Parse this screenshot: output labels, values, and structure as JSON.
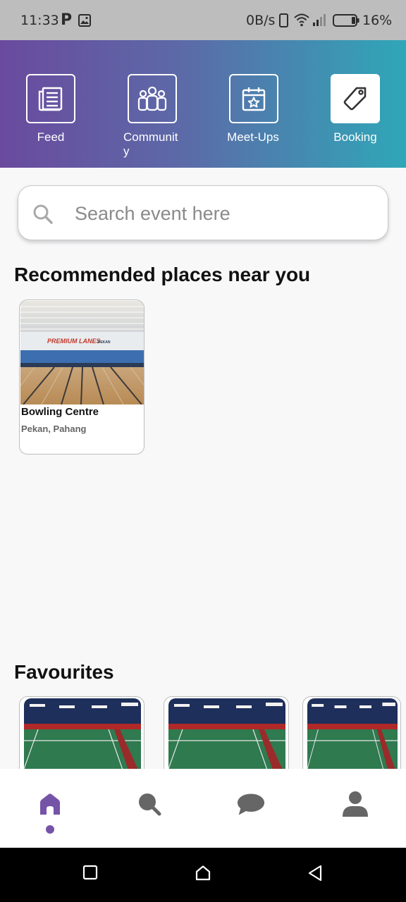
{
  "status_bar": {
    "time": "11:33",
    "p_glyph": "P",
    "net_speed": "0B/s",
    "battery": "16%"
  },
  "header_nav": {
    "items": [
      {
        "label": "Feed",
        "icon": "newspaper-icon",
        "active": false
      },
      {
        "label": "Communit\ny",
        "icon": "people-icon",
        "active": false
      },
      {
        "label": "Meet-Ups",
        "icon": "calendar-star-icon",
        "active": false
      },
      {
        "label": "Booking",
        "icon": "tag-icon",
        "active": true
      }
    ],
    "gradient": [
      "#6a4a9e",
      "#2fa7b8"
    ]
  },
  "search": {
    "placeholder": "Search event here",
    "value": ""
  },
  "recommended": {
    "title": "Recommended places near you",
    "places": [
      {
        "name": "Bowling Centre",
        "location": "Pekan, Pahang",
        "sign_text": "PREMIUM LANES PEKAN"
      }
    ]
  },
  "favourites": {
    "title": "Favourites",
    "count_visible": 3
  },
  "bottom_nav": {
    "items": [
      "home-icon",
      "search-icon",
      "chat-icon",
      "profile-icon"
    ],
    "active": "home-icon",
    "accent": "#7554a8",
    "inactive": "#666666"
  },
  "system_nav": [
    "recents-button",
    "home-button",
    "back-button"
  ]
}
